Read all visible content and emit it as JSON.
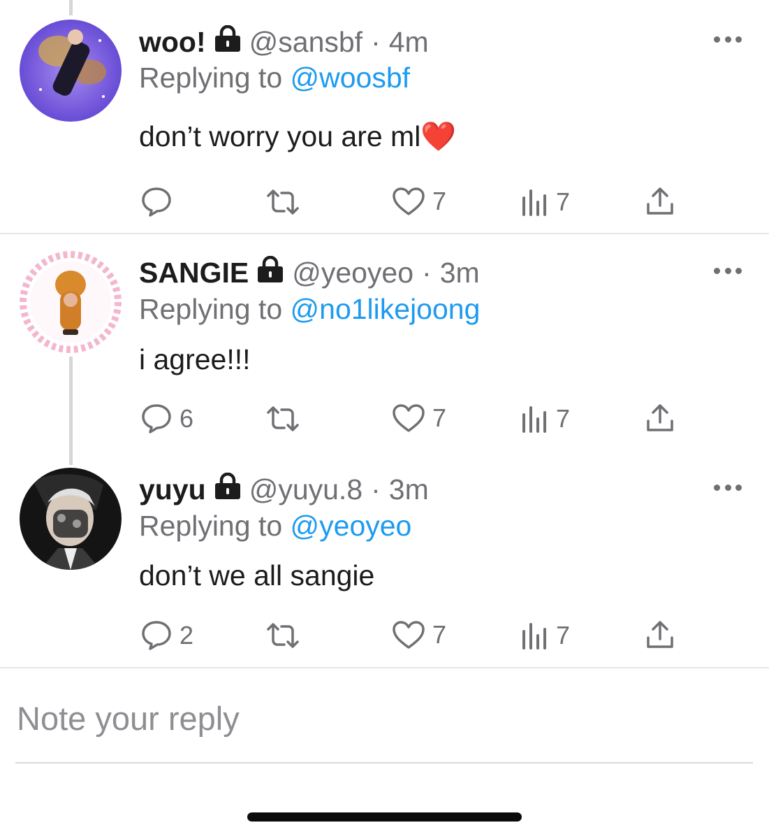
{
  "tweets": [
    {
      "name": "woo!",
      "handle": "@sansbf",
      "dot": "·",
      "time": "4m",
      "replying_prefix": "Replying to ",
      "replying_to": "@woosbf",
      "text": "don’t worry you are ml",
      "emoji": "❤️",
      "reply_count": "",
      "like_count": "7",
      "views_count": "7"
    },
    {
      "name": "SANGIE",
      "handle": "@yeoyeo",
      "dot": "·",
      "time": "3m",
      "replying_prefix": "Replying to ",
      "replying_to": "@no1likejoong",
      "text": "i agree!!!",
      "reply_count": "6",
      "like_count": "7",
      "views_count": "7"
    },
    {
      "name": "yuyu",
      "handle": "@yuyu.8",
      "dot": "·",
      "time": "3m",
      "replying_prefix": "Replying to ",
      "replying_to": "@yeoyeo",
      "text": "don’t we all sangie",
      "reply_count": "2",
      "like_count": "7",
      "views_count": "7"
    }
  ],
  "composer": {
    "placeholder": "Note your reply"
  },
  "icons": {
    "lock": "lock-icon",
    "more": "more-icon",
    "reply": "reply-icon",
    "retweet": "retweet-icon",
    "like": "heart-icon",
    "views": "views-icon",
    "share": "share-icon"
  },
  "colors": {
    "accent": "#1d9bf0",
    "muted": "#6f6f74",
    "text": "#1c1c1c",
    "heart": "#e0223b"
  }
}
